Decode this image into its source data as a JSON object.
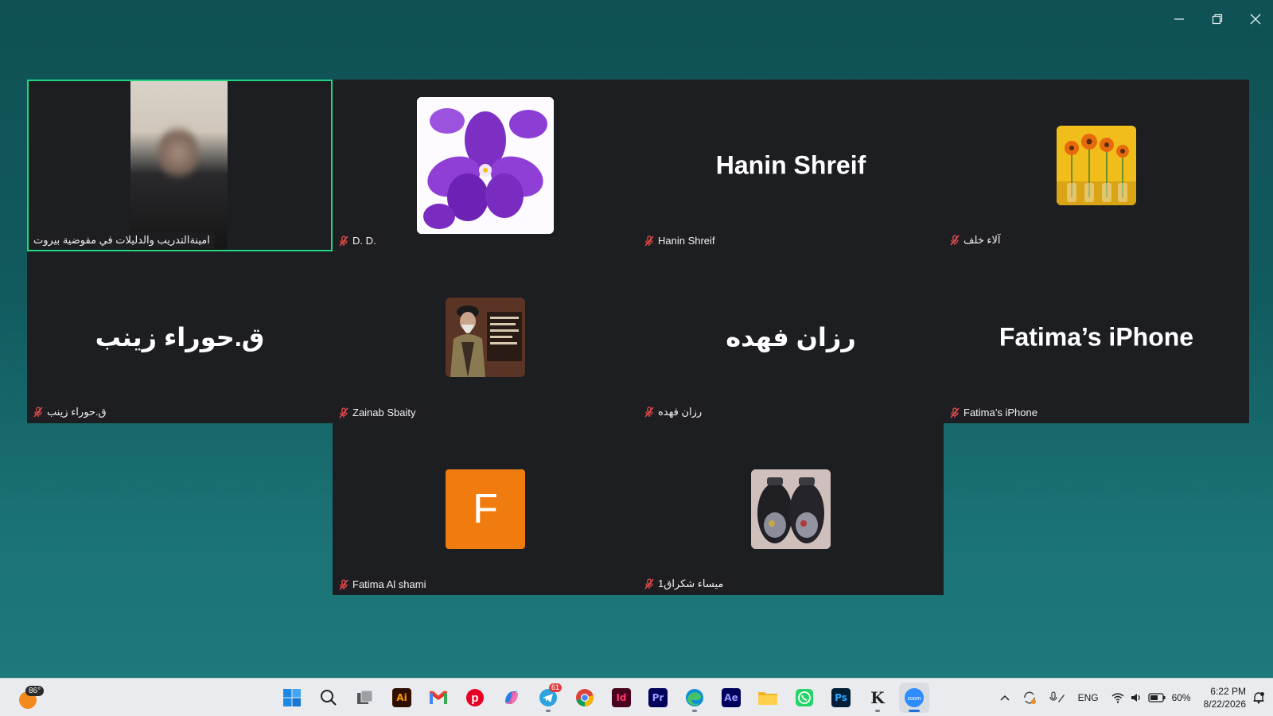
{
  "window": {
    "minimize": "minimize",
    "restore": "restore",
    "close": "close"
  },
  "participants": [
    {
      "id": "p1",
      "tag": "امينةالتدريب والدليلات في مفوضية بيروت",
      "display": "video",
      "muted": false,
      "active": true
    },
    {
      "id": "p2",
      "tag": "D. D.",
      "display": "photo-violet",
      "muted": true
    },
    {
      "id": "p3",
      "tag": "Hanin Shreif",
      "display": "name",
      "big_name": "Hanin Shreif",
      "muted": true
    },
    {
      "id": "p4",
      "tag": "آلاء خلف",
      "display": "photo-sunflowers",
      "muted": true
    },
    {
      "id": "p5",
      "tag": "ق.حوراء زينب",
      "display": "name",
      "big_name": "ق.حوراء زينب",
      "muted": true
    },
    {
      "id": "p6",
      "tag": "Zainab Sbaity",
      "display": "photo-portrait",
      "muted": true
    },
    {
      "id": "p7",
      "tag": "رزان فهده",
      "display": "name",
      "big_name": "رزان فهده",
      "muted": true
    },
    {
      "id": "p8",
      "tag": "Fatima’s iPhone",
      "display": "name",
      "big_name": "Fatima’s iPhone",
      "muted": true
    },
    {
      "id": "p9",
      "tag": "Fatima Al shami",
      "display": "letter",
      "letter": "F",
      "color": "#f07b0e",
      "muted": true
    },
    {
      "id": "p10",
      "tag": "ميساء شكراق1",
      "display": "photo-shoes",
      "muted": true
    }
  ],
  "taskbar": {
    "weather_temp": "86°",
    "apps": [
      {
        "name": "start",
        "icon": "windows-icon"
      },
      {
        "name": "search",
        "icon": "search-icon"
      },
      {
        "name": "task-view",
        "icon": "task-view-icon"
      },
      {
        "name": "illustrator",
        "icon": "illustrator-icon",
        "label": "Ai",
        "color": "#2f1000",
        "fg": "#ff9a00"
      },
      {
        "name": "gmail",
        "icon": "gmail-icon",
        "label": "M",
        "color": "#ffffff",
        "fg": "#d93025"
      },
      {
        "name": "pinterest",
        "icon": "pinterest-icon",
        "label": "P",
        "color": "#e60023",
        "fg": "#ffffff"
      },
      {
        "name": "copilot",
        "icon": "copilot-icon"
      },
      {
        "name": "telegram",
        "icon": "telegram-icon",
        "badge": "61"
      },
      {
        "name": "chrome",
        "icon": "chrome-icon"
      },
      {
        "name": "indesign",
        "icon": "indesign-icon",
        "label": "Id",
        "color": "#49021f",
        "fg": "#ff3366"
      },
      {
        "name": "premiere",
        "icon": "premiere-icon",
        "label": "Pr",
        "color": "#00005b",
        "fg": "#9999ff"
      },
      {
        "name": "edge",
        "icon": "edge-icon"
      },
      {
        "name": "after-effects",
        "icon": "after-effects-icon",
        "label": "Ae",
        "color": "#00005b",
        "fg": "#9999ff"
      },
      {
        "name": "file-explorer",
        "icon": "folder-icon"
      },
      {
        "name": "whatsapp",
        "icon": "whatsapp-icon"
      },
      {
        "name": "photoshop",
        "icon": "photoshop-icon",
        "label": "Ps",
        "color": "#001e36",
        "fg": "#31a8ff"
      },
      {
        "name": "kmplayer",
        "icon": "kmplayer-icon",
        "label": "K"
      },
      {
        "name": "zoom",
        "icon": "zoom-icon",
        "label": "zoom",
        "active": true
      }
    ],
    "language": "ENG",
    "battery": "60%",
    "time": "6:22 PM",
    "date": "8/22/2026"
  }
}
